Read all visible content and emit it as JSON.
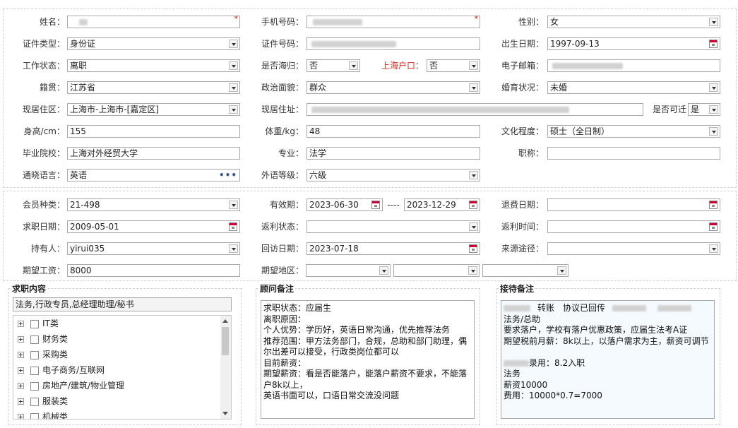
{
  "labels": {
    "name": "姓名：",
    "phone": "手机号码：",
    "gender": "性别：",
    "id_type": "证件类型：",
    "id_number": "证件号码：",
    "birth_date": "出生日期：",
    "work_status": "工作状态：",
    "returnee": "是否海归：",
    "shanghai_hukou": "上海户口：",
    "email": "电子邮箱：",
    "origin": "籍贯：",
    "political": "政治面貌：",
    "marital": "婚育状况：",
    "current_area": "现居住区：",
    "current_address": "现居住址：",
    "relocate": "是否可迁",
    "height": "身高/cm：",
    "weight": "体重/kg：",
    "education": "文化程度：",
    "school": "毕业院校：",
    "major": "专业：",
    "title": "职称：",
    "language": "通晓语言：",
    "language_level": "外语等级：",
    "member_type": "会员种类：",
    "valid_period": "有效期：",
    "refund_date": "退费日期：",
    "job_date": "求职日期：",
    "rebate_status": "返利状态：",
    "rebate_time": "返利时间：",
    "holder": "持有人：",
    "visit_date": "回访日期：",
    "source": "来源途径：",
    "expected_salary": "期望工资：",
    "expected_area": "期望地区："
  },
  "values": {
    "required_mark": "*",
    "gender": "女",
    "id_type": "身份证",
    "birth_date": "1997-09-13",
    "work_status": "离职",
    "returnee": "否",
    "shanghai_hukou": "否",
    "origin": "江苏省",
    "political": "群众",
    "marital": "未婚",
    "current_area": "上海市-上海市-[嘉定区]",
    "relocate": "是",
    "height": "155",
    "weight": "48",
    "education": "硕士（全日制）",
    "school": "上海对外经贸大学",
    "major": "法学",
    "title": "",
    "language": "英语",
    "language_level": "六级",
    "more_glyph": "•••",
    "member_type": "21-498",
    "valid_from": "2023-06-30",
    "valid_sep": "----",
    "valid_to": "2023-12-29",
    "refund_date": "",
    "job_date": "2009-05-01",
    "rebate_status": "",
    "rebate_time": "",
    "holder": "yirui035",
    "visit_date": "2023-07-18",
    "source": "",
    "expected_salary": "8000"
  },
  "job_content": {
    "title": "求职内容",
    "value": "法务,行政专员,总经理助理/秘书",
    "categories": [
      "IT类",
      "财务类",
      "采购类",
      "电子商务/互联网",
      "房地产/建筑/物业管理",
      "服装类",
      "机械类"
    ]
  },
  "consultant_notes": {
    "title": "顾问备注",
    "text": "求职状态：应届生\n离职原因：\n个人优势：学历好，英语日常沟通，优先推荐法务\n推荐范围：甲方法务部门，合规，总助和部门助理，偶尔出差可以接受，行政类岗位都可以\n目前薪资：\n期望薪资：看是否能落户，能落户薪资不要求，不能落户8k以上，\n英语书面可以，口语日常交流没问题"
  },
  "reception_notes": {
    "title": "接待备注",
    "line1_a": "转账",
    "line1_b": "协议已回传",
    "lines_top": "法务/总助\n要求落户，学校有落户优惠政策，应届生法考A证\n期望税前月薪：8k以上，以落户需求为主，薪资可调节",
    "line_hire": "录用：8.2入职",
    "lines_bottom": "法务\n薪资10000\n费用：10000*0.7=7000"
  },
  "colors": {
    "label_red": "#d9261c",
    "required": "#e00000",
    "calendar_red": "#cc0033"
  }
}
